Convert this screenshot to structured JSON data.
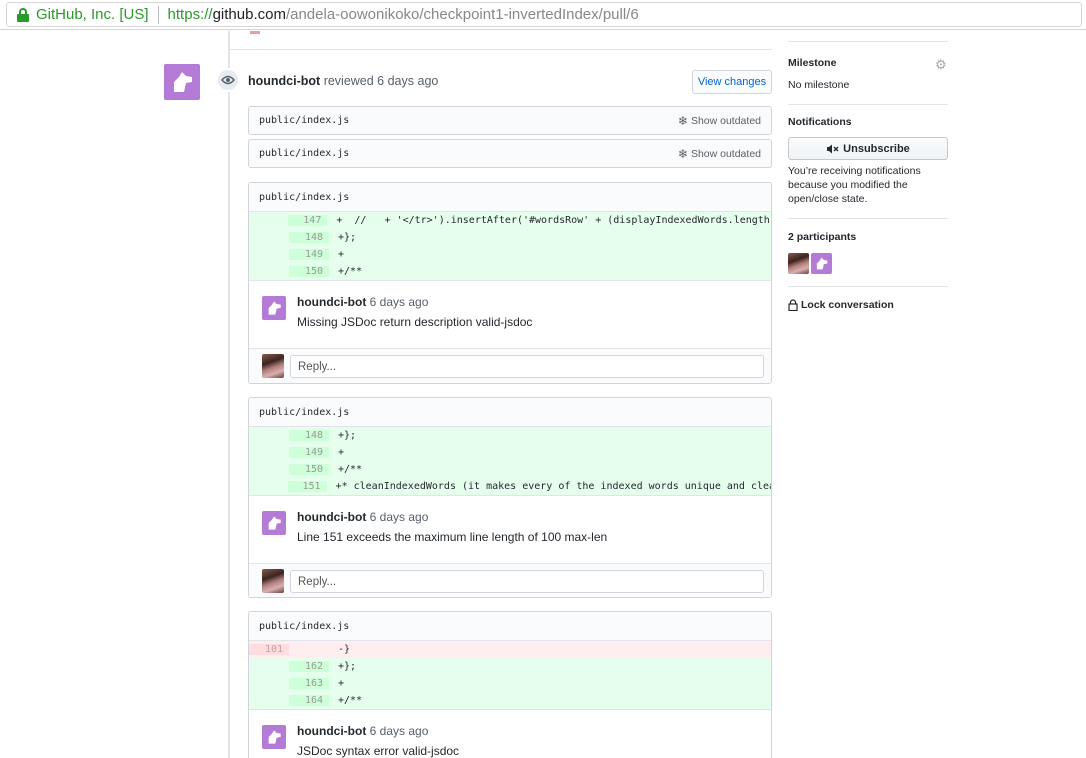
{
  "browser": {
    "org": "GitHub, Inc. [US]",
    "url_scheme": "https://",
    "url_host": "github.com",
    "url_path": "/andela-oowonikoko/checkpoint1-invertedIndex/pull/6"
  },
  "review": {
    "author": "houndci-bot",
    "action": "reviewed 6 days ago",
    "view_changes_label": "View changes"
  },
  "outdated_files": [
    {
      "filename": "public/index.js",
      "show_outdated_label": "Show outdated"
    },
    {
      "filename": "public/index.js",
      "show_outdated_label": "Show outdated"
    }
  ],
  "threads": [
    {
      "filename": "public/index.js",
      "lines": [
        {
          "old": "",
          "new": "147",
          "type": "add",
          "code": "+  //   + '</tr>').insertAfter('#wordsRow' + (displayIndexedWords.length -"
        },
        {
          "old": "",
          "new": "148",
          "type": "add",
          "code": "+};"
        },
        {
          "old": "",
          "new": "149",
          "type": "add",
          "code": "+"
        },
        {
          "old": "",
          "new": "150",
          "type": "add",
          "code": "+/**"
        }
      ],
      "comment_author": "houndci-bot",
      "comment_time": "6 days ago",
      "comment_body": "Missing JSDoc return description valid-jsdoc",
      "reply_placeholder": "Reply..."
    },
    {
      "filename": "public/index.js",
      "lines": [
        {
          "old": "",
          "new": "148",
          "type": "add",
          "code": "+};"
        },
        {
          "old": "",
          "new": "149",
          "type": "add",
          "code": "+"
        },
        {
          "old": "",
          "new": "150",
          "type": "add",
          "code": "+/**"
        },
        {
          "old": "",
          "new": "151",
          "type": "add",
          "code": "+* cleanIndexedWords (it makes every of the indexed words unique and cleans"
        }
      ],
      "comment_author": "houndci-bot",
      "comment_time": "6 days ago",
      "comment_body": "Line 151 exceeds the maximum line length of 100 max-len",
      "reply_placeholder": "Reply..."
    },
    {
      "filename": "public/index.js",
      "lines": [
        {
          "old": "101",
          "new": "",
          "type": "del",
          "code": "-}"
        },
        {
          "old": "",
          "new": "162",
          "type": "add",
          "code": "+};"
        },
        {
          "old": "",
          "new": "163",
          "type": "add",
          "code": "+"
        },
        {
          "old": "",
          "new": "164",
          "type": "add",
          "code": "+/**"
        }
      ],
      "comment_author": "houndci-bot",
      "comment_time": "6 days ago",
      "comment_body": "JSDoc syntax error valid-jsdoc"
    }
  ],
  "sidebar": {
    "milestone_title": "Milestone",
    "milestone_value": "No milestone",
    "notifications_title": "Notifications",
    "unsubscribe_label": "Unsubscribe",
    "notifications_text_1": "You’re receiving notifications",
    "notifications_text_2": "because you modified the",
    "notifications_text_3": "open/close state.",
    "participants_title": "2 participants",
    "lock_label": "Lock conversation"
  },
  "colors": {
    "accent": "#0366d6",
    "addition_bg": "#e6ffed",
    "deletion_bg": "#ffeef0",
    "bot_avatar": "#b37ad6",
    "secure_green": "#2a9a2a"
  }
}
